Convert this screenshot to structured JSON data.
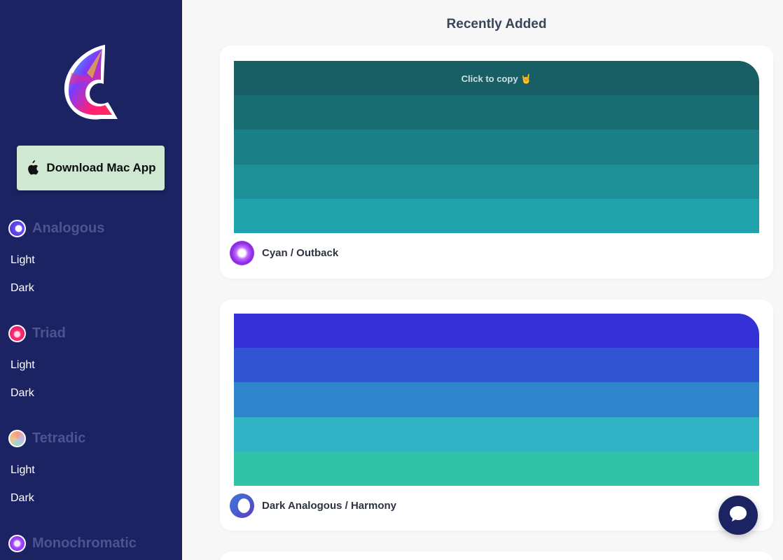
{
  "sidebar": {
    "download_label": "Download Mac App",
    "sections": [
      {
        "title": "Analogous",
        "items": [
          "Light",
          "Dark"
        ]
      },
      {
        "title": "Triad",
        "items": [
          "Light",
          "Dark"
        ]
      },
      {
        "title": "Tetradic",
        "items": [
          "Light",
          "Dark"
        ]
      },
      {
        "title": "Monochromatic",
        "items": []
      }
    ]
  },
  "main": {
    "title": "Recently Added",
    "cards": [
      {
        "name": "Cyan / Outback",
        "hint": "Click to copy 🤘",
        "colors": [
          "#175e65",
          "#186d73",
          "#1a7f86",
          "#1d9098",
          "#20a3ac"
        ]
      },
      {
        "name": "Dark Analogous / Harmony",
        "colors": [
          "#3432d6",
          "#2f54d4",
          "#2e85cc",
          "#31b3c6",
          "#2fc4a8"
        ]
      }
    ]
  },
  "colors": {
    "sidebar_bg": "#1b2363",
    "download_bg": "#cfe8d2"
  }
}
